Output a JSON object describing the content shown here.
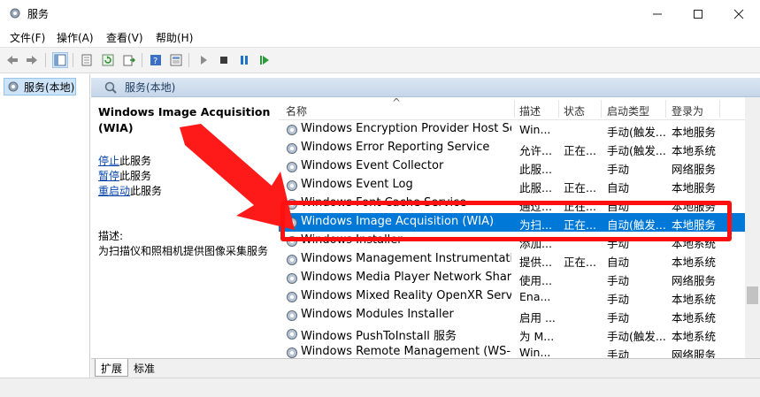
{
  "window": {
    "title": "服务"
  },
  "menu": [
    "文件(F)",
    "操作(A)",
    "查看(V)",
    "帮助(H)"
  ],
  "tree": {
    "root": "服务(本地)"
  },
  "panel": {
    "header": "服务(本地)"
  },
  "details": {
    "service_name": "Windows Image Acquisition (WIA)",
    "action_stop_link": "停止",
    "action_stop_suffix": "此服务",
    "action_pause_link": "暂停",
    "action_pause_suffix": "此服务",
    "action_restart_link": "重启动",
    "action_restart_suffix": "此服务",
    "description_label": "描述:",
    "description_text": "为扫描仪和照相机提供图像采集服务"
  },
  "columns": {
    "name": "名称",
    "description": "描述",
    "status": "状态",
    "startup": "启动类型",
    "logon": "登录为"
  },
  "rows": [
    {
      "name": "Windows Encryption Provider Host Ser...",
      "desc": "Win...",
      "status": "",
      "startup": "手动(触发...",
      "logon": "本地服务"
    },
    {
      "name": "Windows Error Reporting Service",
      "desc": "允许...",
      "status": "正在...",
      "startup": "手动(触发...",
      "logon": "本地系统"
    },
    {
      "name": "Windows Event Collector",
      "desc": "此服...",
      "status": "",
      "startup": "手动",
      "logon": "网络服务"
    },
    {
      "name": "Windows Event Log",
      "desc": "此服...",
      "status": "正在...",
      "startup": "自动",
      "logon": "本地服务"
    },
    {
      "name": "Windows Font Cache Service",
      "desc": "通过...",
      "status": "正在...",
      "startup": "自动",
      "logon": "本地服务"
    },
    {
      "name": "Windows Image Acquisition (WIA)",
      "desc": "为扫...",
      "status": "正在...",
      "startup": "自动(触发...",
      "logon": "本地服务"
    },
    {
      "name": "Windows Installer",
      "desc": "添加...",
      "status": "",
      "startup": "手动",
      "logon": "本地系统"
    },
    {
      "name": "Windows Management Instrumentation",
      "desc": "提供...",
      "status": "正在...",
      "startup": "自动",
      "logon": "本地系统"
    },
    {
      "name": "Windows Media Player Network Sharin...",
      "desc": "使用...",
      "status": "",
      "startup": "手动",
      "logon": "网络服务"
    },
    {
      "name": "Windows Mixed Reality OpenXR Service",
      "desc": "Ena...",
      "status": "",
      "startup": "手动",
      "logon": "本地系统"
    },
    {
      "name": "Windows Modules Installer",
      "desc": "启用 ...",
      "status": "",
      "startup": "手动",
      "logon": "本地系统"
    },
    {
      "name": "Windows PushToInstall 服务",
      "desc": "为 M...",
      "status": "",
      "startup": "手动(触发...",
      "logon": "本地系统"
    },
    {
      "name": "Windows Remote Management (WS-M...",
      "desc": "Win...",
      "status": "",
      "startup": "手动",
      "logon": "网络服务"
    }
  ],
  "selected_row": 5,
  "tabs": [
    "扩展",
    "标准"
  ],
  "colors": {
    "selection": "#0078d7",
    "highlight": "#ff1010",
    "header_band": "#c6d6e9"
  }
}
